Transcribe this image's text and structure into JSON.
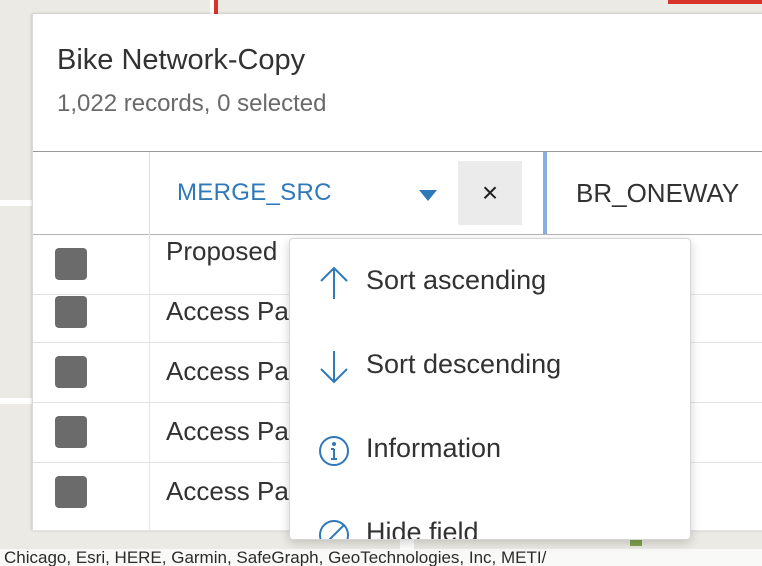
{
  "layer": {
    "title": "Bike Network-Copy",
    "summary": "1,022 records, 0 selected"
  },
  "columns": {
    "merge_src": "MERGE_SRC",
    "close_symbol": "×",
    "br_oneway": "BR_ONEWAY"
  },
  "rows": [
    {
      "value": "Proposed"
    },
    {
      "value": "Access Pa"
    },
    {
      "value": "Access Pa"
    },
    {
      "value": "Access Pa"
    },
    {
      "value": "Access Pa"
    }
  ],
  "menu": {
    "items": [
      {
        "label": "Sort ascending",
        "icon": "arrow-up-icon"
      },
      {
        "label": "Sort descending",
        "icon": "arrow-down-icon"
      },
      {
        "label": "Information",
        "icon": "info-icon"
      },
      {
        "label": "Hide field",
        "icon": "hide-icon"
      }
    ]
  },
  "map": {
    "attribution": "Chicago, Esri, HERE, Garmin, SafeGraph, GeoTechnologies, Inc, METI/"
  },
  "colors": {
    "accent": "#2f78b9",
    "resizer": "#86aee3",
    "checkbox": "#6b6b6b"
  }
}
